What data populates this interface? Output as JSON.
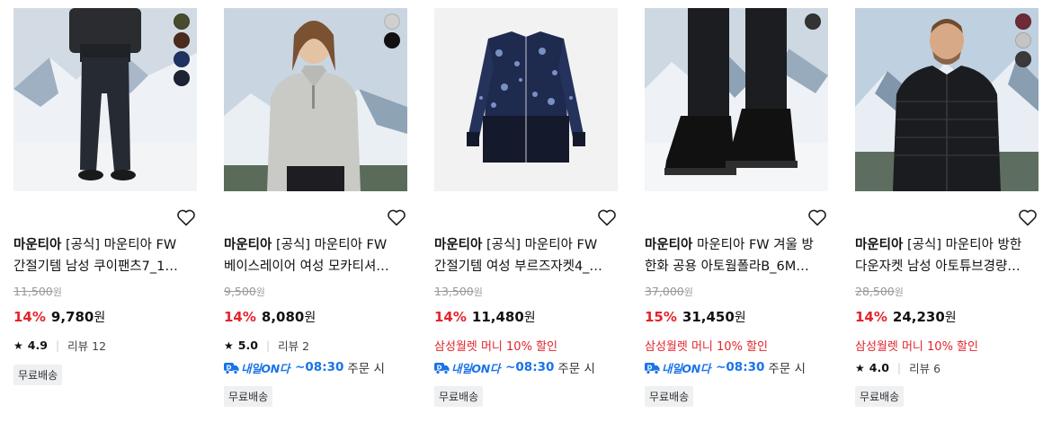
{
  "colors": {
    "discount": "#e3242b",
    "delivery_accent": "#1a73e8"
  },
  "products": [
    {
      "swatches": [
        "#4a4a2e",
        "#4a2c1f",
        "#1e3360",
        "#1c2434"
      ],
      "title_line1_brand": "마운티아",
      "title_line1_rest": " [공식] 마운티아 FW",
      "title_line2": "간절기템 남성 쿠이팬츠7_1…",
      "orig_price": "11,500",
      "discount": "14%",
      "sale_price": "9,780",
      "won": "원",
      "rating": "4.9",
      "reviews": "리뷰 12",
      "ship": "무료배송"
    },
    {
      "swatches": [
        "#cfcfcf",
        "#111111"
      ],
      "title_line1_brand": "마운티아",
      "title_line1_rest": " [공식] 마운티아 FW",
      "title_line2": "베이스레이어 여성 모카티셔…",
      "orig_price": "9,500",
      "discount": "14%",
      "sale_price": "8,080",
      "won": "원",
      "rating": "5.0",
      "reviews": "리뷰 2",
      "delivery_brand": "내일ON다",
      "delivery_time": "~08:30",
      "delivery_suffix": "주문 시",
      "ship": "무료배송"
    },
    {
      "swatches": [],
      "title_line1_brand": "마운티아",
      "title_line1_rest": " [공식] 마운티아 FW",
      "title_line2": "간절기템 여성 부르즈자켓4_…",
      "orig_price": "13,500",
      "discount": "14%",
      "sale_price": "11,480",
      "won": "원",
      "promo": "삼성월렛 머니 10% 할인",
      "delivery_brand": "내일ON다",
      "delivery_time": "~08:30",
      "delivery_suffix": "주문 시",
      "ship": "무료배송"
    },
    {
      "swatches": [
        "#333333"
      ],
      "title_line1_brand": "마운티아",
      "title_line1_rest": " 마운티아 FW 겨울 방",
      "title_line2": "한화 공용 아토웜폴라B_6M…",
      "orig_price": "37,000",
      "discount": "15%",
      "sale_price": "31,450",
      "won": "원",
      "promo": "삼성월렛 머니 10% 할인",
      "delivery_brand": "내일ON다",
      "delivery_time": "~08:30",
      "delivery_suffix": "주문 시",
      "ship": "무료배송"
    },
    {
      "swatches": [
        "#6e2b35",
        "#c4c4c4",
        "#3a3a3a"
      ],
      "title_line1_brand": "마운티아",
      "title_line1_rest": " [공식] 마운티아 방한",
      "title_line2": "다운자켓 남성 아토튜브경량…",
      "orig_price": "28,500",
      "discount": "14%",
      "sale_price": "24,230",
      "won": "원",
      "promo": "삼성월렛 머니 10% 할인",
      "rating": "4.0",
      "reviews": "리뷰 6",
      "ship": "무료배송"
    }
  ]
}
